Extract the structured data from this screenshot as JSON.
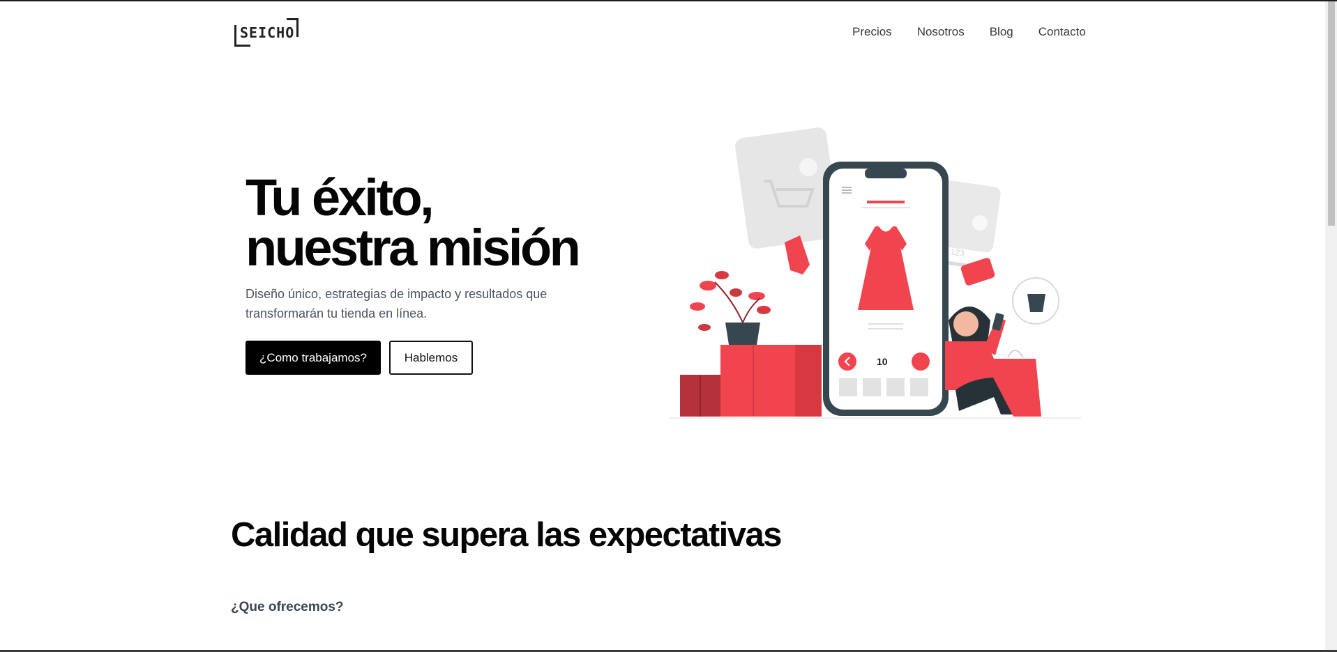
{
  "header": {
    "logo_text": "SEICHO",
    "nav": [
      "Precios",
      "Nosotros",
      "Blog",
      "Contacto"
    ]
  },
  "hero": {
    "title_line1": "Tu éxito,",
    "title_line2": "nuestra misión",
    "subtitle": "Diseño único, estrategias de impacto y resultados que transformarán tu tienda en línea.",
    "primary_button": "¿Como trabajamos?",
    "secondary_button": "Hablemos",
    "illustration": {
      "price_text": "10",
      "card_number": "56 567 790 123",
      "accent_color": "#f0444f",
      "dark_color": "#37474f"
    }
  },
  "section": {
    "title": "Calidad que supera las expectativas",
    "subtitle": "¿Que ofrecemos?"
  }
}
